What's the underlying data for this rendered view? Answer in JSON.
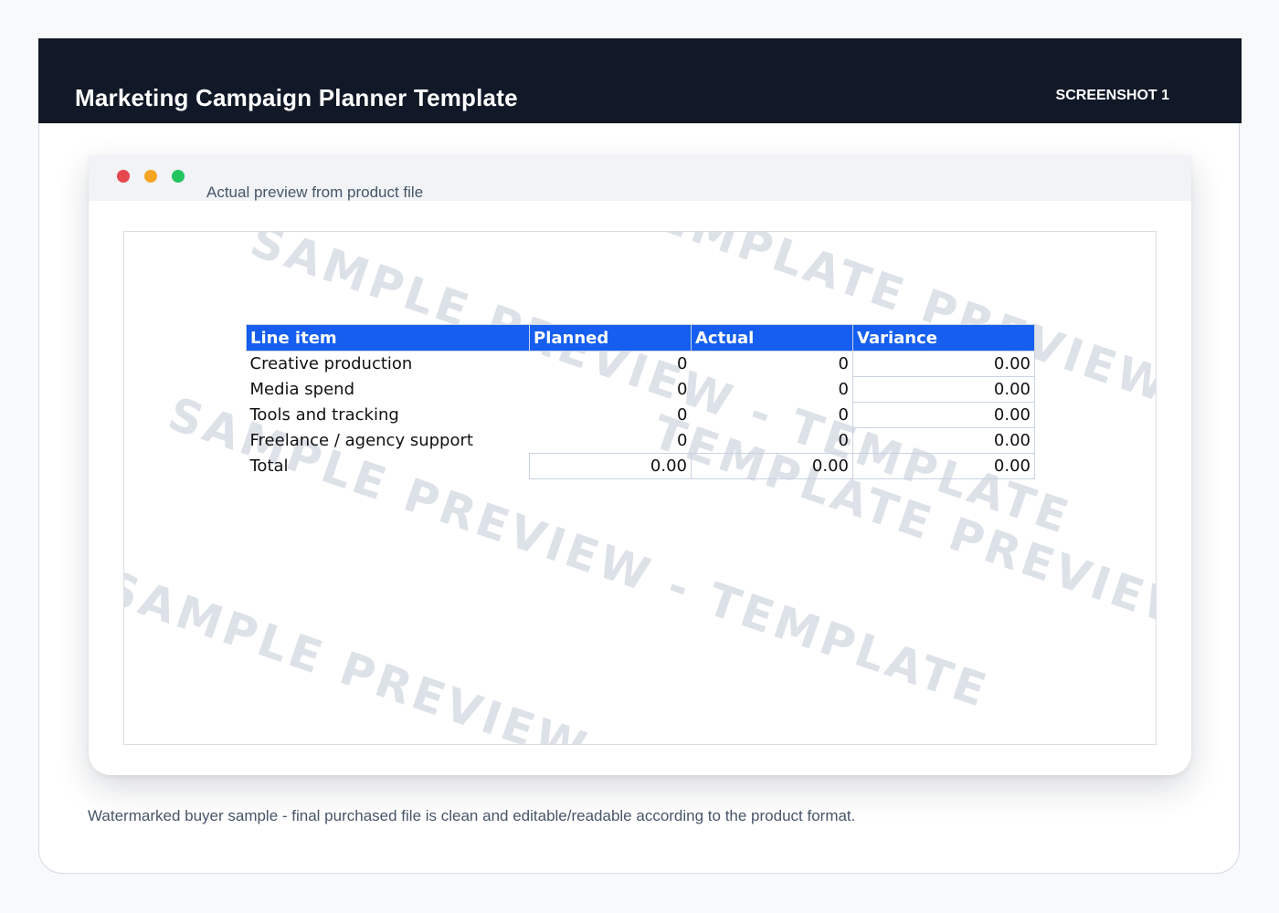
{
  "header": {
    "title": "Marketing Campaign Planner Template",
    "tag": "SCREENSHOT 1"
  },
  "window": {
    "caption": "Actual preview from product file",
    "dot_colors": [
      "#e5484d",
      "#f5a524",
      "#22c55e"
    ]
  },
  "watermark": {
    "lines": [
      "SAMPLE PREVIEW - TEMPLATE",
      "TEMPLATE PREVIEW - SAMPLE",
      "SAMPLE PREVIEW - TEMPLATE",
      "TEMPLATE PREVIEW - SAMPLE",
      "SAMPLE PREVIEW - TEMPLATE"
    ]
  },
  "table": {
    "headers": [
      "Line item",
      "Planned",
      "Actual",
      "Variance"
    ],
    "rows": [
      {
        "item": "Creative production",
        "planned": "0",
        "actual": "0",
        "variance": "0.00"
      },
      {
        "item": "Media spend",
        "planned": "0",
        "actual": "0",
        "variance": "0.00"
      },
      {
        "item": "Tools and tracking",
        "planned": "0",
        "actual": "0",
        "variance": "0.00"
      },
      {
        "item": "Freelance / agency support",
        "planned": "0",
        "actual": "0",
        "variance": "0.00"
      }
    ],
    "total": {
      "item": "Total",
      "planned": "0.00",
      "actual": "0.00",
      "variance": "0.00"
    },
    "header_color": "#155eef"
  },
  "footnote": "Watermarked buyer sample - final purchased file is clean and editable/readable according to the product format."
}
